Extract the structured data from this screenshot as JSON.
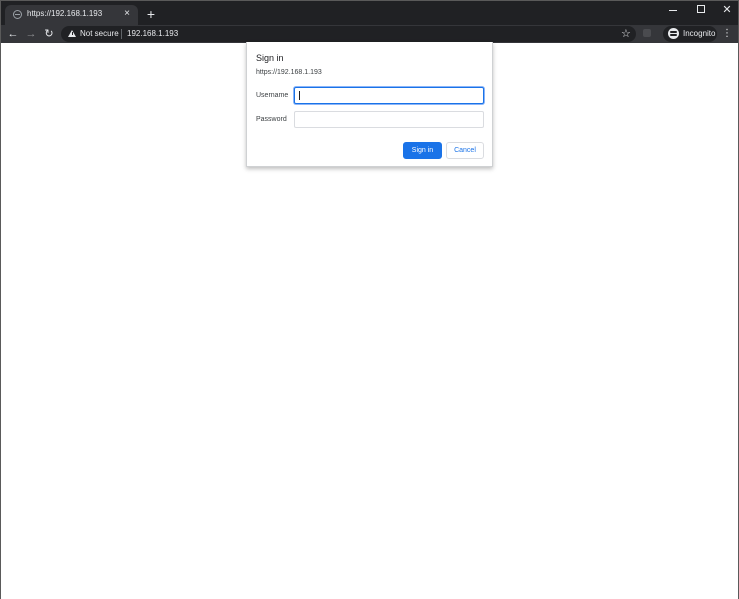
{
  "browser": {
    "tab": {
      "title": "https://192.168.1.193",
      "close_glyph": "×"
    },
    "new_tab_glyph": "+",
    "window_controls": {
      "close_glyph": "✕"
    },
    "nav": {
      "back_glyph": "←",
      "forward_glyph": "→",
      "reload_glyph": "↻"
    },
    "omnibox": {
      "security_label": "Not secure",
      "url": "192.168.1.193",
      "star_glyph": "☆"
    },
    "profile": {
      "label": "Incognito"
    },
    "menu_glyph": "⋮"
  },
  "dialog": {
    "title": "Sign in",
    "origin": "https://192.168.1.193",
    "username_label": "Username",
    "username_value": "",
    "password_label": "Password",
    "password_value": "",
    "signin_button": "Sign in",
    "cancel_button": "Cancel"
  },
  "colors": {
    "accent": "#1a73e8",
    "frame_dark": "#202124",
    "toolbar": "#35363a"
  },
  "icons": {
    "tab_favicon": "globe-icon",
    "security": "warning-icon",
    "bookmark": "star-icon",
    "profile": "incognito-icon",
    "menu": "more-vert-icon"
  }
}
